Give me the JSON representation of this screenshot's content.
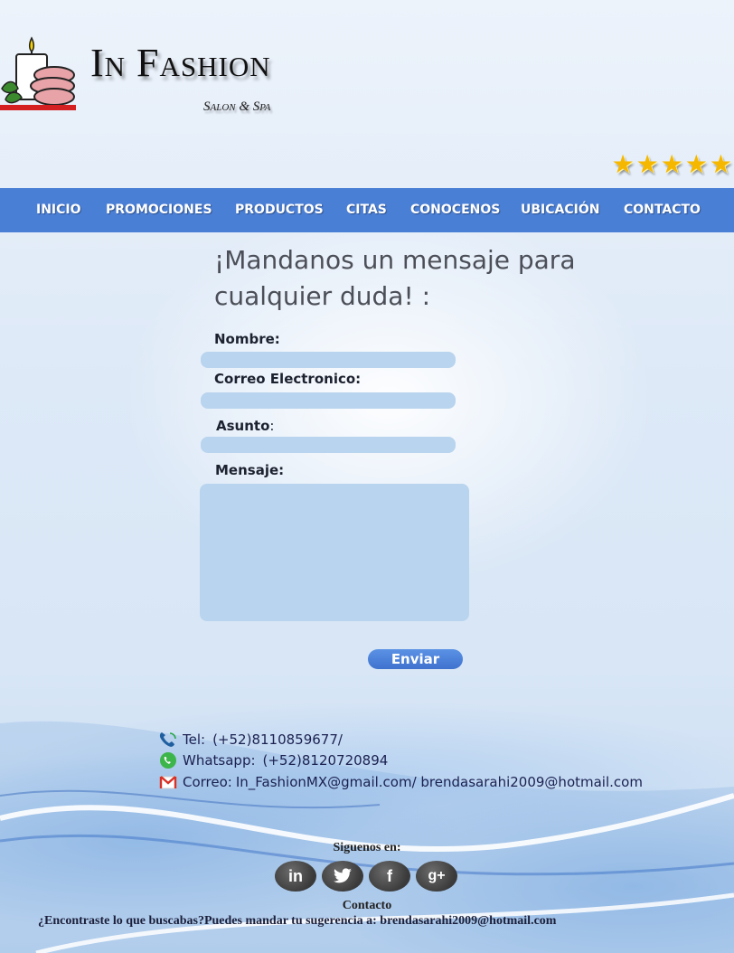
{
  "brand": {
    "title": "In Fashion",
    "subtitle": "Salon & Spa"
  },
  "rating": {
    "stars": 5
  },
  "nav": {
    "items": [
      "INICIO",
      "PROMOCIONES",
      "PRODUCTOS",
      "CITAS",
      "CONOCENOS",
      "UBICACIÓN",
      "CONTACTO"
    ]
  },
  "form": {
    "heading": "¡Mandanos un mensaje para cualquier duda! :",
    "name_label": "Nombre:",
    "email_label": "Correo Electronico:",
    "subject_label": "Asunto",
    "subject_colon": ":",
    "message_label": "Mensaje:",
    "name_value": "",
    "email_value": "",
    "subject_value": "",
    "message_value": "",
    "send_label": "Enviar"
  },
  "contact": {
    "tel_label": "Tel:",
    "tel_value": "(+52)8110859677/",
    "whatsapp_label": "Whatsapp:",
    "whatsapp_value": "(+52)8120720894",
    "email_label": "Correo:",
    "email_value": "In_FashionMX@gmail.com/ brendasarahi2009@hotmail.com"
  },
  "social": {
    "heading": "Siguenos en:",
    "icons": [
      "linkedin-icon",
      "twitter-icon",
      "facebook-icon",
      "google-plus-icon"
    ]
  },
  "footer": {
    "contact_label": "Contacto",
    "note": "¿Encontraste lo que buscabas?Puedes mandar tu sugerencia a: brendasarahi2009@hotmail.com"
  },
  "colors": {
    "nav_bg": "#4a7fd6",
    "field_bg": "#b9d4ee",
    "button_bg": "#4a7fd6"
  }
}
